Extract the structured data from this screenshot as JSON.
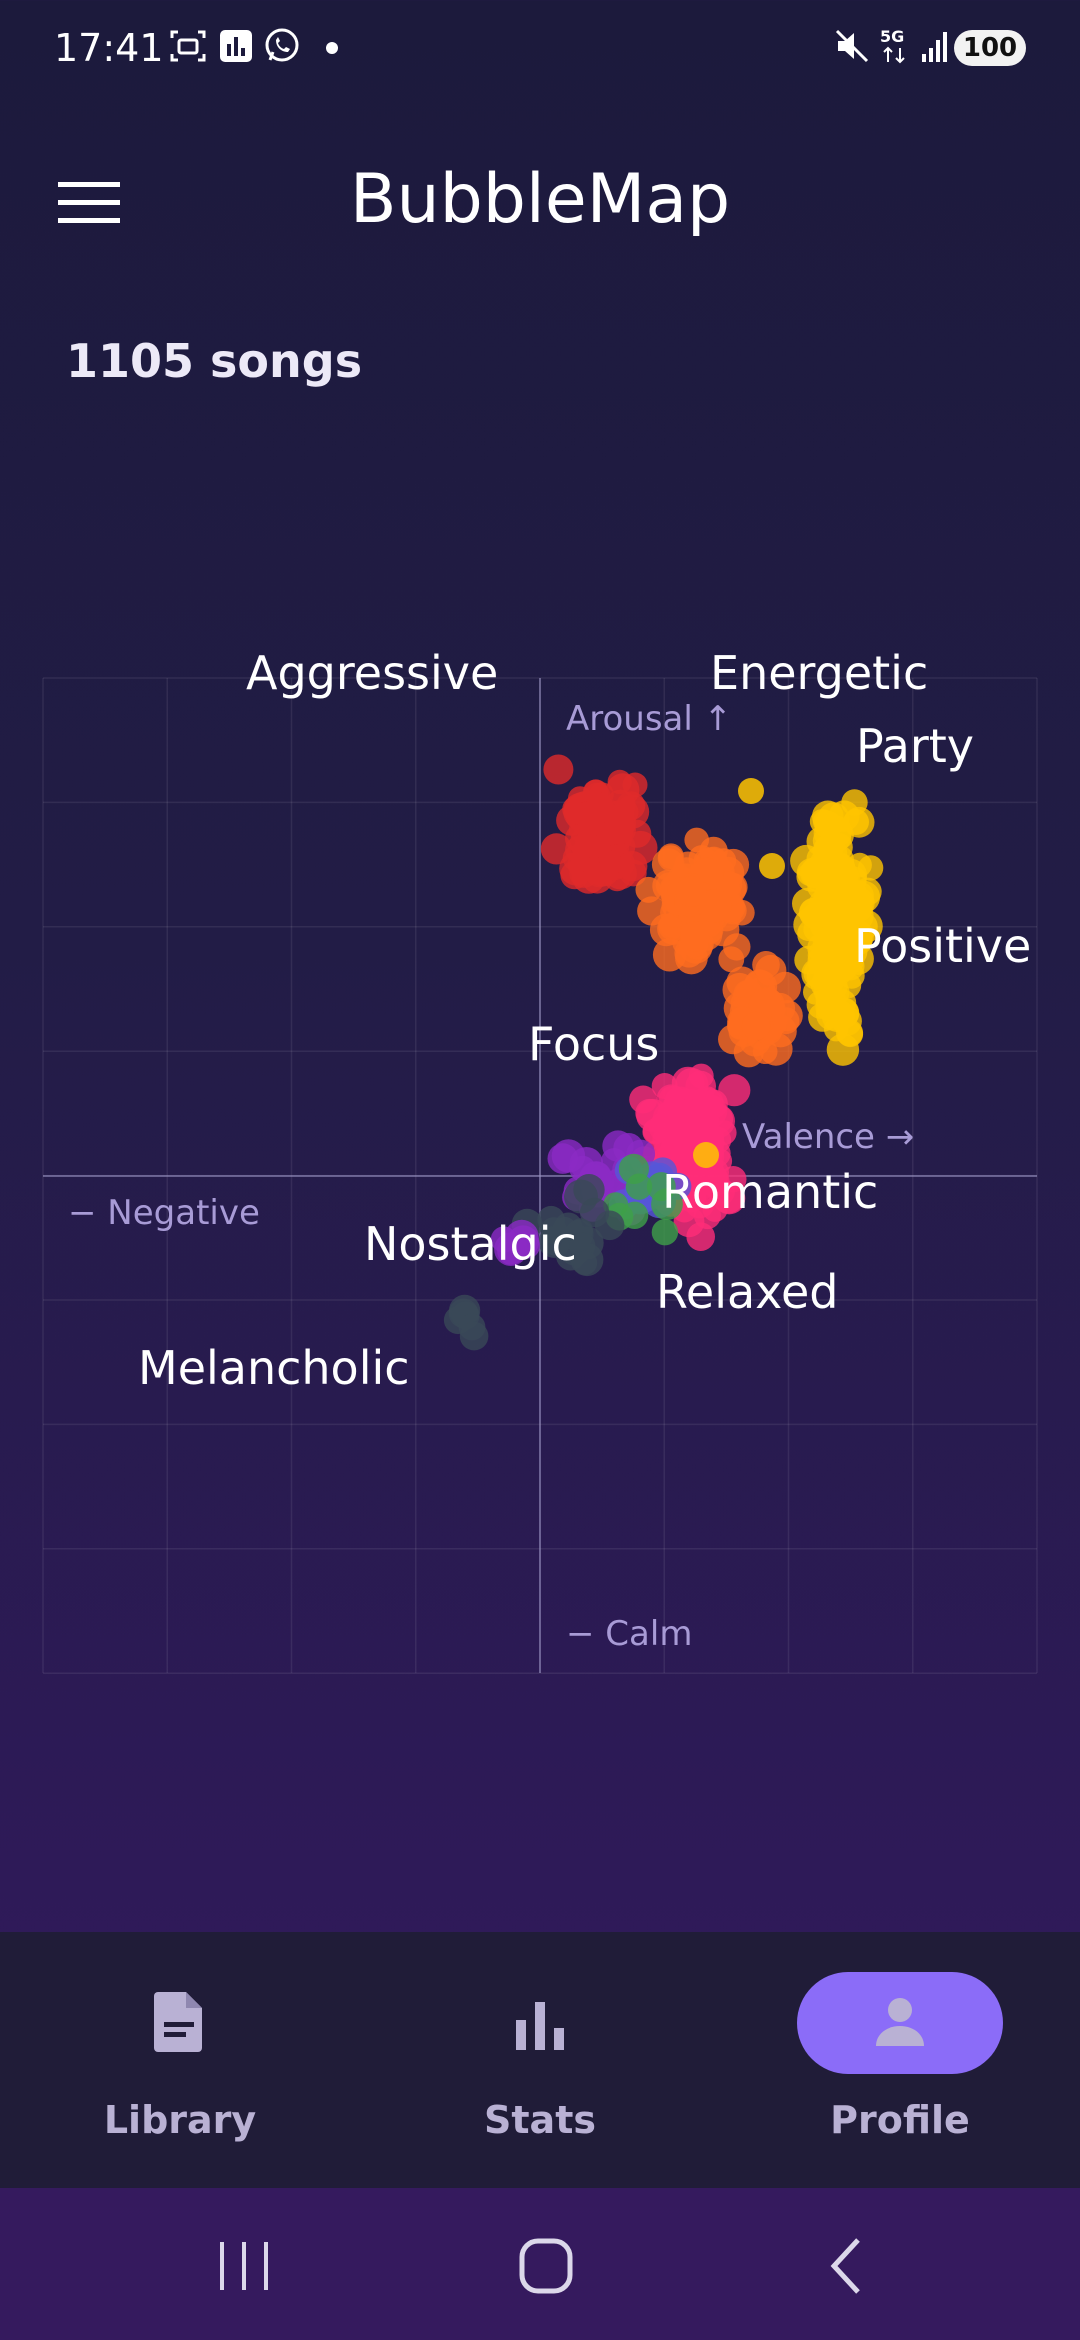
{
  "status_bar": {
    "time": "17:41",
    "battery": "100",
    "left_icons": [
      "screenshot-icon",
      "chart-app-icon",
      "whatsapp-icon",
      "notification-dot-icon"
    ],
    "right_icons": [
      "mute-icon",
      "5g-icon",
      "signal-icon"
    ]
  },
  "app_bar": {
    "title": "BubbleMap",
    "menu_icon": "hamburger-menu-icon"
  },
  "summary": {
    "song_count": "1105 songs"
  },
  "map": {
    "axis_labels": {
      "arousal_up": "Arousal ↑",
      "calm": "− Calm",
      "negative": "− Negative",
      "valence_right": "Valence →"
    },
    "mood_labels": [
      "Aggressive",
      "Energetic",
      "Party",
      "Positive",
      "Focus",
      "Romantic",
      "Nostalgic",
      "Relaxed",
      "Melancholic"
    ],
    "colors": {
      "yellow": "#ffc400",
      "orange": "#ff6d1f",
      "red": "#e02a2a",
      "pink": "#ff2d78",
      "purple": "#8b2bc4",
      "blue": "#5656d8",
      "green": "#3fa048",
      "gray": "#3a4858"
    }
  },
  "bottom_nav": {
    "items": [
      {
        "label": "Library",
        "icon": "document-icon",
        "active": false
      },
      {
        "label": "Stats",
        "icon": "bar-chart-icon",
        "active": false
      },
      {
        "label": "Profile",
        "icon": "person-icon",
        "active": true
      }
    ],
    "colors": {
      "active_pill": "#8b6cf8",
      "icon": "#b9b1d4"
    }
  },
  "system_nav": {
    "buttons": [
      "recents-icon",
      "home-icon",
      "back-icon"
    ]
  }
}
